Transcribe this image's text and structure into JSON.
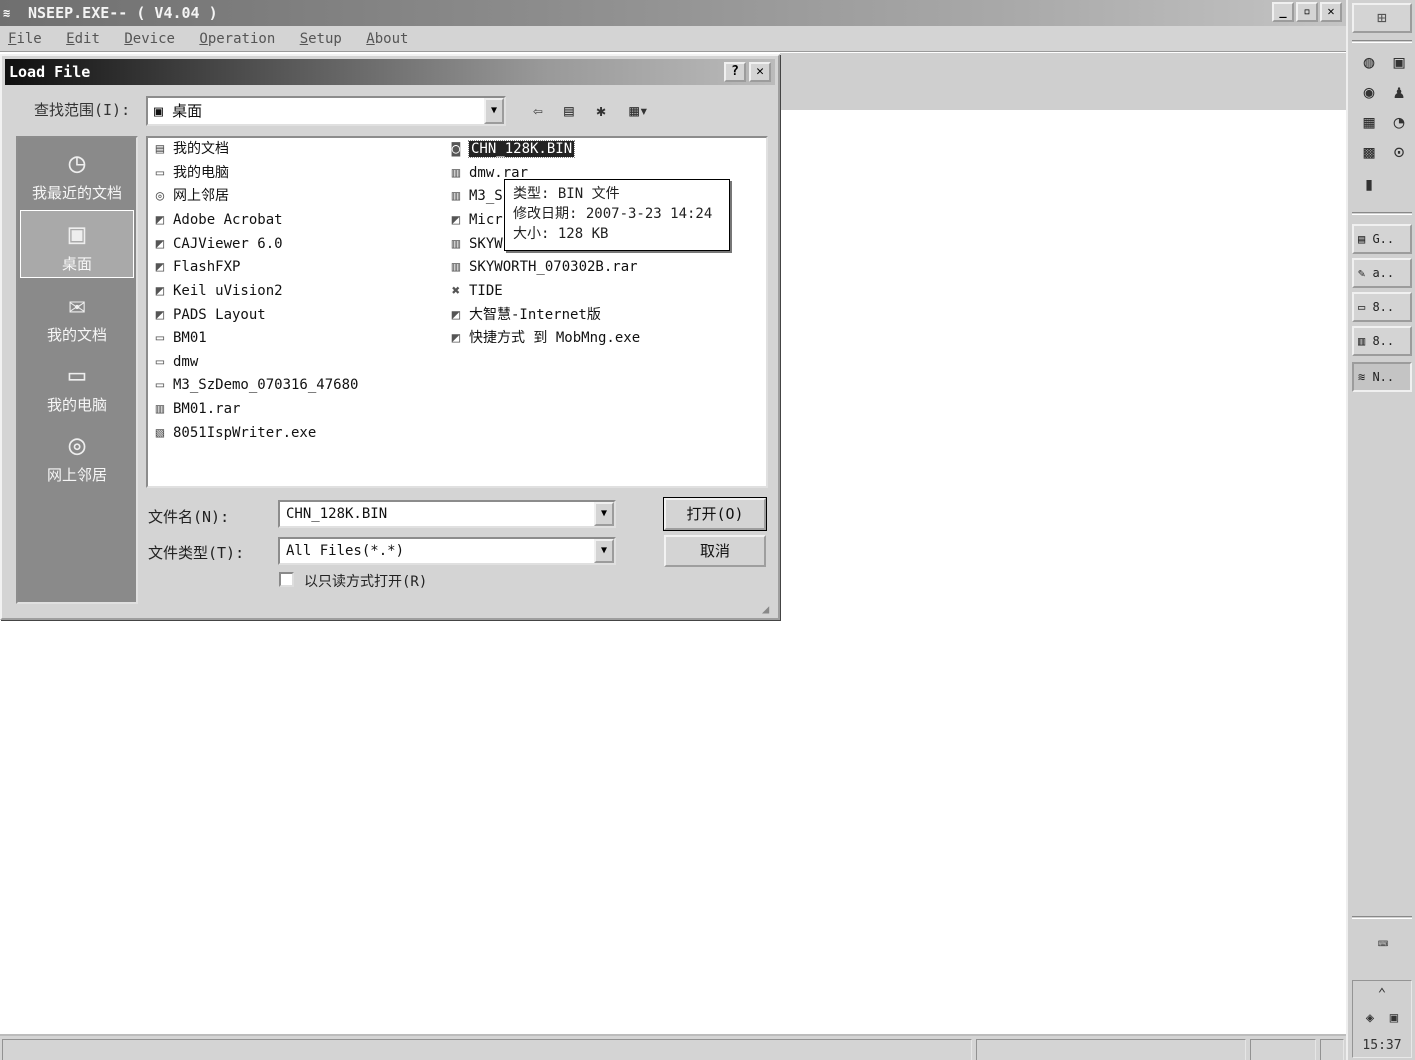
{
  "app": {
    "title": "NSEEP.EXE-- ( V4.04 )",
    "icon": "nseep-app-icon",
    "minimize": "_",
    "restore": "▫",
    "close": "✕"
  },
  "menu": [
    "File",
    "Edit",
    "Device",
    "Operation",
    "Setup",
    "About"
  ],
  "dialog": {
    "title": "Load File",
    "help": "?",
    "close": "✕",
    "look_in_label": "查找范围(I):",
    "look_in_value": "桌面",
    "places": [
      {
        "label": "我最近的文档",
        "icon": "recent-docs-icon"
      },
      {
        "label": "桌面",
        "icon": "desktop-icon"
      },
      {
        "label": "我的文档",
        "icon": "my-documents-icon"
      },
      {
        "label": "我的电脑",
        "icon": "my-computer-icon"
      },
      {
        "label": "网上邻居",
        "icon": "network-places-icon"
      }
    ],
    "files_col1": [
      "我的文档",
      "我的电脑",
      "网上邻居",
      "Adobe Acrobat",
      "CAJViewer 6.0",
      "FlashFXP",
      "Keil uVision2",
      "PADS Layout",
      "BM01",
      "dmw",
      "M3_SzDemo_070316_47680",
      "BM01.rar",
      "8051IspWriter.exe"
    ],
    "files_col2": [
      "CHN_128K.BIN",
      "dmw.rar",
      "M3_S",
      "Micr",
      "SKYW",
      "SKYWORTH_070302B.rar",
      "TIDE",
      "大智慧-Internet版",
      "快捷方式 到 MobMng.exe"
    ],
    "tooltip": {
      "type": "类型: BIN 文件",
      "modified": "修改日期: 2007-3-23 14:24",
      "size": "大小: 128 KB"
    },
    "filename_label": "文件名(N):",
    "filename_value": "CHN_128K.BIN",
    "filetype_label": "文件类型(T):",
    "filetype_value": "All Files(*.*)",
    "open_button": "打开(O)",
    "cancel_button": "取消",
    "readonly_label": "以只读方式打开(R)",
    "readonly_checked": false
  },
  "taskbar": {
    "tasks": [
      "G..",
      "a..",
      "8..",
      "8..",
      "N.."
    ],
    "clock": "15:37"
  }
}
